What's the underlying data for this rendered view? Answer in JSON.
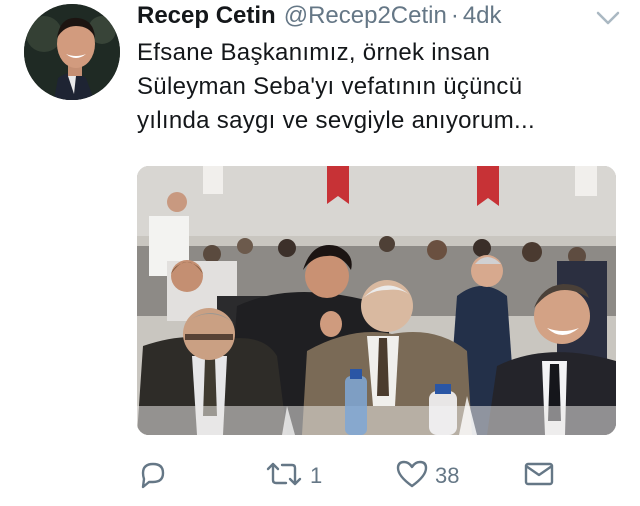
{
  "user": {
    "name": "Recep Cetin",
    "handle": "@Recep2Cetin",
    "separator": "·",
    "time": "4dk"
  },
  "tweet": {
    "lines": [
      "Efsane Başkanımız, örnek insan",
      "Süleyman Seba'yı vefatının üçüncü",
      "yılında saygı ve sevgiyle anıyorum..."
    ]
  },
  "actions": {
    "reply_icon": "reply-icon",
    "retweet_icon": "retweet-icon",
    "retweet_count": "1",
    "like_icon": "heart-icon",
    "like_count": "38",
    "dm_icon": "envelope-icon"
  },
  "colors": {
    "text": "#14171a",
    "muted": "#657786",
    "icon": "#657786"
  }
}
